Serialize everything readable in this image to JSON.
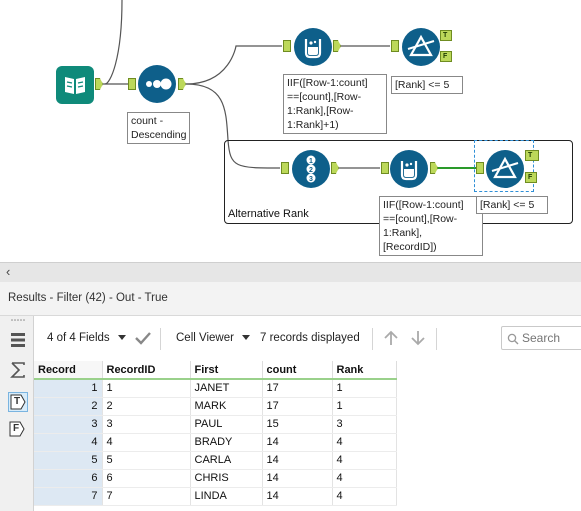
{
  "canvas": {
    "annotations": {
      "sort_config": [
        "count -",
        "Descending"
      ],
      "formula_top": [
        "IIF([Row-1:count]",
        "==[count],[Row-",
        "1:Rank],[Row-",
        "1:Rank]+1)"
      ],
      "filter_top": "[Rank] <= 5",
      "formula_bottom": [
        "IIF([Row-1:count]",
        "==[count],[Row-",
        "1:Rank],",
        "[RecordID])"
      ],
      "filter_bottom": "[Rank] <= 5"
    },
    "container_title": "Alternative Rank",
    "anchor_labels": {
      "true": "T",
      "false": "F"
    },
    "colors": {
      "tool_blue": "#0e5f8a",
      "input_teal": "#0f8a7a",
      "anchor_green": "#bcd85a",
      "selected_wire": "#2a9a2a"
    }
  },
  "splitter": {
    "chevron": "‹"
  },
  "results": {
    "title": "Results - Filter (42) - Out - True",
    "toolbar": {
      "fields": "4 of 4 Fields",
      "viewer": "Cell Viewer",
      "records": "7 records displayed",
      "search_placeholder": "Search"
    },
    "side_buttons": {
      "table": "T",
      "filter": "F"
    },
    "table": {
      "columns": [
        "Record",
        "RecordID",
        "First",
        "count",
        "Rank"
      ],
      "rows": [
        [
          "1",
          "1",
          "JANET",
          "17",
          "1"
        ],
        [
          "2",
          "2",
          "MARK",
          "17",
          "1"
        ],
        [
          "3",
          "3",
          "PAUL",
          "15",
          "3"
        ],
        [
          "4",
          "4",
          "BRADY",
          "14",
          "4"
        ],
        [
          "5",
          "5",
          "CARLA",
          "14",
          "4"
        ],
        [
          "6",
          "6",
          "CHRIS",
          "14",
          "4"
        ],
        [
          "7",
          "7",
          "LINDA",
          "14",
          "4"
        ]
      ]
    }
  }
}
